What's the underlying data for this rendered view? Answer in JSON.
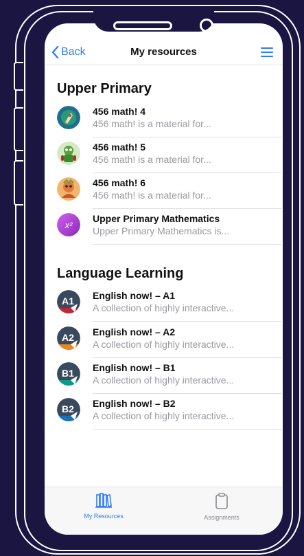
{
  "nav": {
    "back_label": "Back",
    "title": "My resources"
  },
  "sections": [
    {
      "title": "Upper Primary",
      "items": [
        {
          "title": "456 math! 4",
          "subtitle": "456 math! is a material for...",
          "icon": "math-4-rocket-icon",
          "color": "#1f6f8b"
        },
        {
          "title": "456 math! 5",
          "subtitle": "456 math! is a material for...",
          "icon": "math-5-robot-icon",
          "color": "#5aa03c"
        },
        {
          "title": "456 math! 6",
          "subtitle": "456 math! is a material for...",
          "icon": "math-6-character-icon",
          "color": "#e07a3a"
        },
        {
          "title": "Upper Primary Mathematics",
          "subtitle": "Upper Primary Mathematics is...",
          "icon": "x-squared-icon",
          "glyph": "x²",
          "color": "#b040d0"
        }
      ]
    },
    {
      "title": "Language Learning",
      "items": [
        {
          "title": "English now! – A1",
          "subtitle": "A collection of highly interactive...",
          "icon": "a1-level-icon",
          "glyph": "A1",
          "color": "#c0283a"
        },
        {
          "title": "English now! – A2",
          "subtitle": "A collection of highly interactive...",
          "icon": "a2-level-icon",
          "glyph": "A2",
          "color": "#e58a1f"
        },
        {
          "title": "English now! – B1",
          "subtitle": "A collection of highly interactive...",
          "icon": "b1-level-icon",
          "glyph": "B1",
          "color": "#0e9a8a"
        },
        {
          "title": "English now! – B2",
          "subtitle": "A collection of highly interactive...",
          "icon": "b2-level-icon",
          "glyph": "B2",
          "color": "#1b6fb3"
        }
      ]
    }
  ],
  "tabs": [
    {
      "label": "My Resources",
      "icon": "books-icon",
      "active": true
    },
    {
      "label": "Assignments",
      "icon": "clipboard-icon",
      "active": false
    }
  ],
  "colors": {
    "accent": "#2f7cf6",
    "background": "#1a1541",
    "muted": "#9a9aa0"
  }
}
